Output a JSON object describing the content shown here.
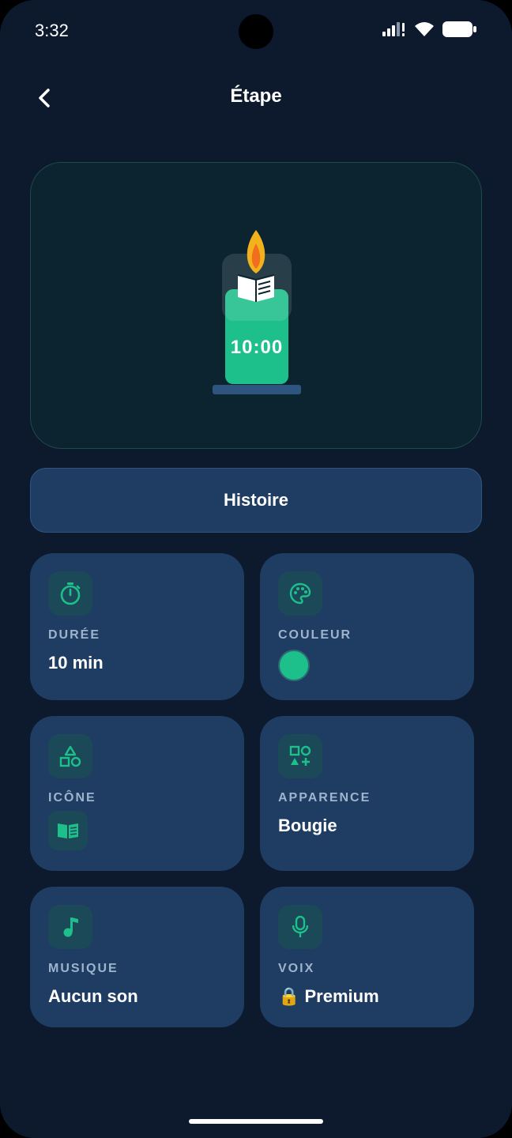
{
  "status": {
    "time": "3:32"
  },
  "header": {
    "title": "Étape"
  },
  "preview": {
    "timer": "10:00",
    "accent_color": "#1dbf8a"
  },
  "histoire_button": {
    "label": "Histoire"
  },
  "settings": {
    "duree": {
      "label": "DURÉE",
      "value": "10 min",
      "icon": "timer-icon"
    },
    "couleur": {
      "label": "COULEUR",
      "value_color": "#1dbf8a",
      "icon": "palette-icon"
    },
    "icone": {
      "label": "ICÔNE",
      "icon": "shapes-icon",
      "selected_icon": "book-icon"
    },
    "apparence": {
      "label": "APPARENCE",
      "value": "Bougie",
      "icon": "category-icon"
    },
    "musique": {
      "label": "MUSIQUE",
      "value": "Aucun son",
      "icon": "music-note-icon"
    },
    "voix": {
      "label": "VOIX",
      "value": "🔒 Premium",
      "icon": "microphone-icon"
    }
  }
}
